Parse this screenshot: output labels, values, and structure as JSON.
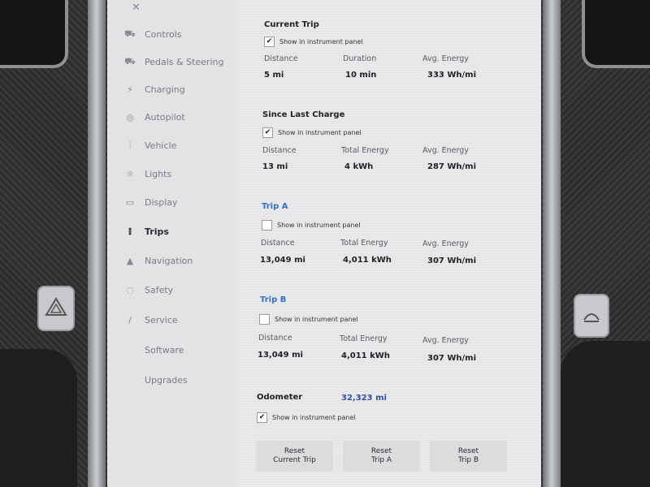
{
  "sidebar": {
    "items": [
      {
        "label": "Controls",
        "icon": "car-icon"
      },
      {
        "label": "Pedals & Steering",
        "icon": "car-icon"
      },
      {
        "label": "Charging",
        "icon": "bolt-icon"
      },
      {
        "label": "Autopilot",
        "icon": "steering-wheel-icon"
      },
      {
        "label": "Vehicle",
        "icon": "sliders-icon"
      },
      {
        "label": "Lights",
        "icon": "sun-icon"
      },
      {
        "label": "Display",
        "icon": "display-icon"
      },
      {
        "label": "Trips",
        "icon": "trips-icon"
      },
      {
        "label": "Navigation",
        "icon": "navigation-icon"
      },
      {
        "label": "Safety",
        "icon": "safety-icon"
      },
      {
        "label": "Service",
        "icon": "wrench-icon"
      },
      {
        "label": "Software",
        "icon": "download-icon"
      },
      {
        "label": "Upgrades",
        "icon": "upgrade-icon"
      }
    ],
    "active": "Trips"
  },
  "current_trip": {
    "title": "Current Trip",
    "checkbox_label": "Show in instrument panel",
    "checked": true,
    "labels": [
      "Distance",
      "Duration",
      "Avg. Energy"
    ],
    "values": [
      "5 mi",
      "10 min",
      "333 Wh/mi"
    ]
  },
  "since_last_charge": {
    "title": "Since Last Charge",
    "checkbox_label": "Show in instrument panel",
    "checked": true,
    "labels": [
      "Distance",
      "Total Energy",
      "Avg. Energy"
    ],
    "values": [
      "13 mi",
      "4 kWh",
      "287 Wh/mi"
    ]
  },
  "trip_a": {
    "title": "Trip A",
    "checkbox_label": "Show in instrument panel",
    "checked": false,
    "labels": [
      "Distance",
      "Total Energy",
      "Avg. Energy"
    ],
    "values": [
      "13,049 mi",
      "4,011 kWh",
      "307 Wh/mi"
    ]
  },
  "trip_b": {
    "title": "Trip B",
    "checkbox_label": "Show in instrument panel",
    "checked": false,
    "labels": [
      "Distance",
      "Total Energy",
      "Avg. Energy"
    ],
    "values": [
      "13,049 mi",
      "4,011 kWh",
      "307 Wh/mi"
    ]
  },
  "odometer": {
    "label": "Odometer",
    "value": "32,323 mi",
    "checkbox_label": "Show in instrument panel",
    "checked": true
  },
  "buttons": {
    "reset_current": [
      "Reset",
      "Current Trip"
    ],
    "reset_a": [
      "Reset",
      "Trip A"
    ],
    "reset_b": [
      "Reset",
      "Trip B"
    ]
  },
  "colors": {
    "accent": "#2f6fd0",
    "screen_bg": "#e9e9eb"
  }
}
